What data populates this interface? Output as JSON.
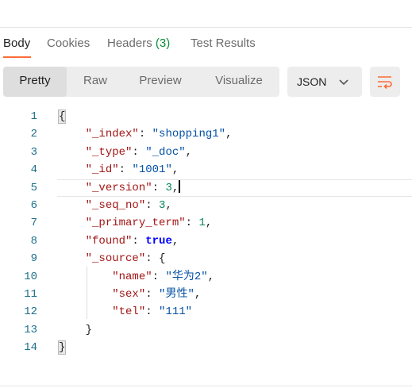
{
  "tabs": [
    {
      "label": "Body",
      "active": true
    },
    {
      "label": "Cookies",
      "active": false
    },
    {
      "label": "Headers",
      "count": "(3)",
      "active": false
    },
    {
      "label": "Test Results",
      "active": false
    }
  ],
  "view_modes": [
    "Pretty",
    "Raw",
    "Preview",
    "Visualize"
  ],
  "active_view_mode": "Pretty",
  "format": {
    "selected": "JSON",
    "icon": "chevron-down-icon"
  },
  "wrap_icon": "wrap-lines-icon",
  "colors": {
    "accent": "#ff6c37",
    "count_green": "#0a8f3a",
    "key": "#a31515",
    "string": "#0451a5",
    "number": "#098658",
    "boolean": "#0000ff",
    "line_number": "#1f6f8b"
  },
  "editor": {
    "line_numbers": [
      "1",
      "2",
      "3",
      "4",
      "5",
      "6",
      "7",
      "8",
      "9",
      "10",
      "11",
      "12",
      "13",
      "14"
    ],
    "current_line": 5,
    "lines": [
      {
        "indent": "",
        "tokens": [
          {
            "t": "p",
            "v": "{"
          }
        ]
      },
      {
        "indent": "    ",
        "tokens": [
          {
            "t": "k",
            "v": "\"_index\""
          },
          {
            "t": "p",
            "v": ": "
          },
          {
            "t": "s",
            "v": "\"shopping1\""
          },
          {
            "t": "p",
            "v": ","
          }
        ]
      },
      {
        "indent": "    ",
        "tokens": [
          {
            "t": "k",
            "v": "\"_type\""
          },
          {
            "t": "p",
            "v": ": "
          },
          {
            "t": "s",
            "v": "\"_doc\""
          },
          {
            "t": "p",
            "v": ","
          }
        ]
      },
      {
        "indent": "    ",
        "tokens": [
          {
            "t": "k",
            "v": "\"_id\""
          },
          {
            "t": "p",
            "v": ": "
          },
          {
            "t": "s",
            "v": "\"1001\""
          },
          {
            "t": "p",
            "v": ","
          }
        ]
      },
      {
        "indent": "    ",
        "tokens": [
          {
            "t": "k",
            "v": "\"_version\""
          },
          {
            "t": "p",
            "v": ": "
          },
          {
            "t": "n",
            "v": "3"
          },
          {
            "t": "p",
            "v": ","
          }
        ]
      },
      {
        "indent": "    ",
        "tokens": [
          {
            "t": "k",
            "v": "\"_seq_no\""
          },
          {
            "t": "p",
            "v": ": "
          },
          {
            "t": "n",
            "v": "3"
          },
          {
            "t": "p",
            "v": ","
          }
        ]
      },
      {
        "indent": "    ",
        "tokens": [
          {
            "t": "k",
            "v": "\"_primary_term\""
          },
          {
            "t": "p",
            "v": ": "
          },
          {
            "t": "n",
            "v": "1"
          },
          {
            "t": "p",
            "v": ","
          }
        ]
      },
      {
        "indent": "    ",
        "tokens": [
          {
            "t": "k",
            "v": "\"found\""
          },
          {
            "t": "p",
            "v": ": "
          },
          {
            "t": "b",
            "v": "true"
          },
          {
            "t": "p",
            "v": ","
          }
        ]
      },
      {
        "indent": "    ",
        "tokens": [
          {
            "t": "k",
            "v": "\"_source\""
          },
          {
            "t": "p",
            "v": ": {"
          }
        ]
      },
      {
        "indent": "        ",
        "tokens": [
          {
            "t": "k",
            "v": "\"name\""
          },
          {
            "t": "p",
            "v": ": "
          },
          {
            "t": "s",
            "v": "\"华为2\""
          },
          {
            "t": "p",
            "v": ","
          }
        ]
      },
      {
        "indent": "        ",
        "tokens": [
          {
            "t": "k",
            "v": "\"sex\""
          },
          {
            "t": "p",
            "v": ": "
          },
          {
            "t": "s",
            "v": "\"男性\""
          },
          {
            "t": "p",
            "v": ","
          }
        ]
      },
      {
        "indent": "        ",
        "tokens": [
          {
            "t": "k",
            "v": "\"tel\""
          },
          {
            "t": "p",
            "v": ": "
          },
          {
            "t": "s",
            "v": "\"111\""
          }
        ]
      },
      {
        "indent": "    ",
        "tokens": [
          {
            "t": "p",
            "v": "}"
          }
        ]
      },
      {
        "indent": "",
        "tokens": [
          {
            "t": "p",
            "v": "}"
          }
        ]
      }
    ]
  }
}
